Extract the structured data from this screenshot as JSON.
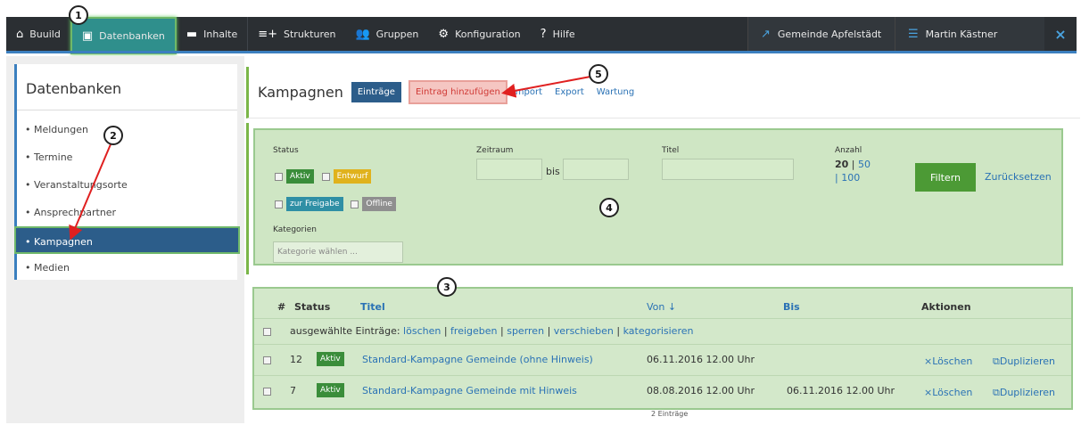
{
  "nav": {
    "items": [
      {
        "label": "Buuild",
        "icon": "home-icon"
      },
      {
        "label": "Datenbanken",
        "icon": "calendar-icon"
      },
      {
        "label": "Inhalte",
        "icon": "folder-icon"
      },
      {
        "label": "Strukturen",
        "icon": "structure-icon"
      },
      {
        "label": "Gruppen",
        "icon": "users-icon"
      },
      {
        "label": "Konfiguration",
        "icon": "gear-icon"
      },
      {
        "label": "Hilfe",
        "icon": "help-icon"
      }
    ],
    "community": "Gemeinde Apfelstädt",
    "user": "Martin Kästner",
    "close": "×"
  },
  "callouts": [
    "1",
    "2",
    "3",
    "4",
    "5"
  ],
  "sidebar": {
    "title": "Datenbanken",
    "items": [
      "• Meldungen",
      "• Termine",
      "• Veranstaltungsorte",
      "• Ansprechpartner",
      "• Kampagnen",
      "• Medien"
    ]
  },
  "header": {
    "title": "Kampagnen",
    "btn_entries": "Einträge",
    "btn_add": "Eintrag hinzufügen",
    "link_import": "Import",
    "link_export": "Export",
    "link_maintenance": "Wartung"
  },
  "filter": {
    "status_label": "Status",
    "status": [
      "Aktiv",
      "Entwurf",
      "zur Freigabe",
      "Offline"
    ],
    "period_label": "Zeitraum",
    "bis": "bis",
    "title_label": "Titel",
    "count_label": "Anzahl",
    "count_20": "20",
    "count_sep": " | ",
    "count_50": "50",
    "count_100": "| 100",
    "category_label": "Kategorien",
    "category_placeholder": "Kategorie wählen ...",
    "btn_filter": "Filtern",
    "reset": "Zurücksetzen"
  },
  "table": {
    "headers": {
      "num": "#",
      "status": "Status",
      "title": "Titel",
      "from": "Von ↓",
      "to": "Bis",
      "actions": "Aktionen"
    },
    "bulk_label": "ausgewählte Einträge:",
    "bulk_actions": [
      "löschen",
      "freigeben",
      "sperren",
      "verschieben",
      "kategorisieren"
    ],
    "bulk_sep": "|",
    "rows": [
      {
        "id": "12",
        "status": "Aktiv",
        "title": "Standard-Kampagne Gemeinde (ohne Hinweis)",
        "from": "06.11.2016 12.00 Uhr",
        "to": "",
        "delete": "×Löschen",
        "duplicate": "⧉Duplizieren"
      },
      {
        "id": "7",
        "status": "Aktiv",
        "title": "Standard-Kampagne Gemeinde mit Hinweis",
        "from": "08.08.2016 12.00 Uhr",
        "to": "06.11.2016 12.00 Uhr",
        "delete": "×Löschen",
        "duplicate": "⧉Duplizieren"
      }
    ],
    "footer": "2 Einträge"
  }
}
